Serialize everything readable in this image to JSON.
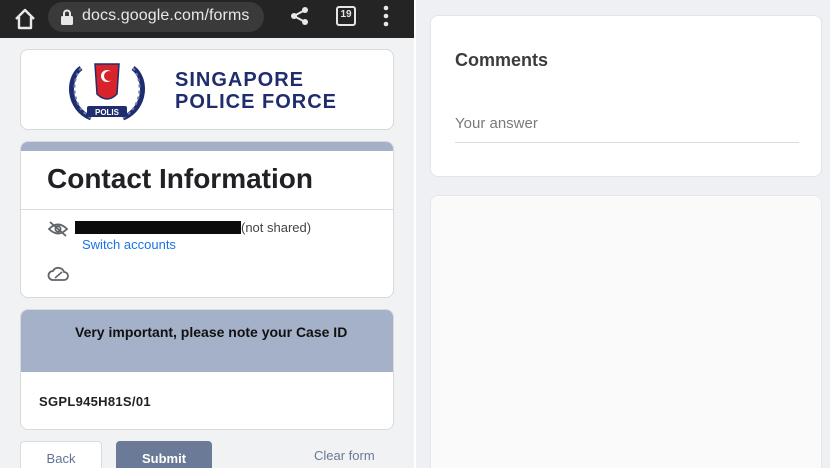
{
  "browser": {
    "url": "docs.google.com/forms",
    "tab_count": "19",
    "icons": [
      "home-icon",
      "lock-icon",
      "share-icon",
      "tabs-icon",
      "kebab-menu-icon"
    ]
  },
  "header": {
    "org_line1": "SINGAPORE",
    "org_line2": "POLICE FORCE",
    "crest_text": "POLIS"
  },
  "contact": {
    "title": "Contact Information",
    "not_shared": "(not shared)",
    "switch_accounts": "Switch accounts"
  },
  "case_section": {
    "header": "Very important, please note your Case ID",
    "value": "SGPL945H81S/01"
  },
  "actions": {
    "back": "Back",
    "submit": "Submit",
    "clear": "Clear form"
  },
  "comments": {
    "label": "Comments",
    "placeholder": "Your answer"
  },
  "colors": {
    "brand_navy": "#1f2d6e",
    "accent_slate": "#a4b0c7",
    "submit_bg": "#6b7a97",
    "link_blue": "#1a73e8",
    "crest_red": "#d8232a"
  }
}
